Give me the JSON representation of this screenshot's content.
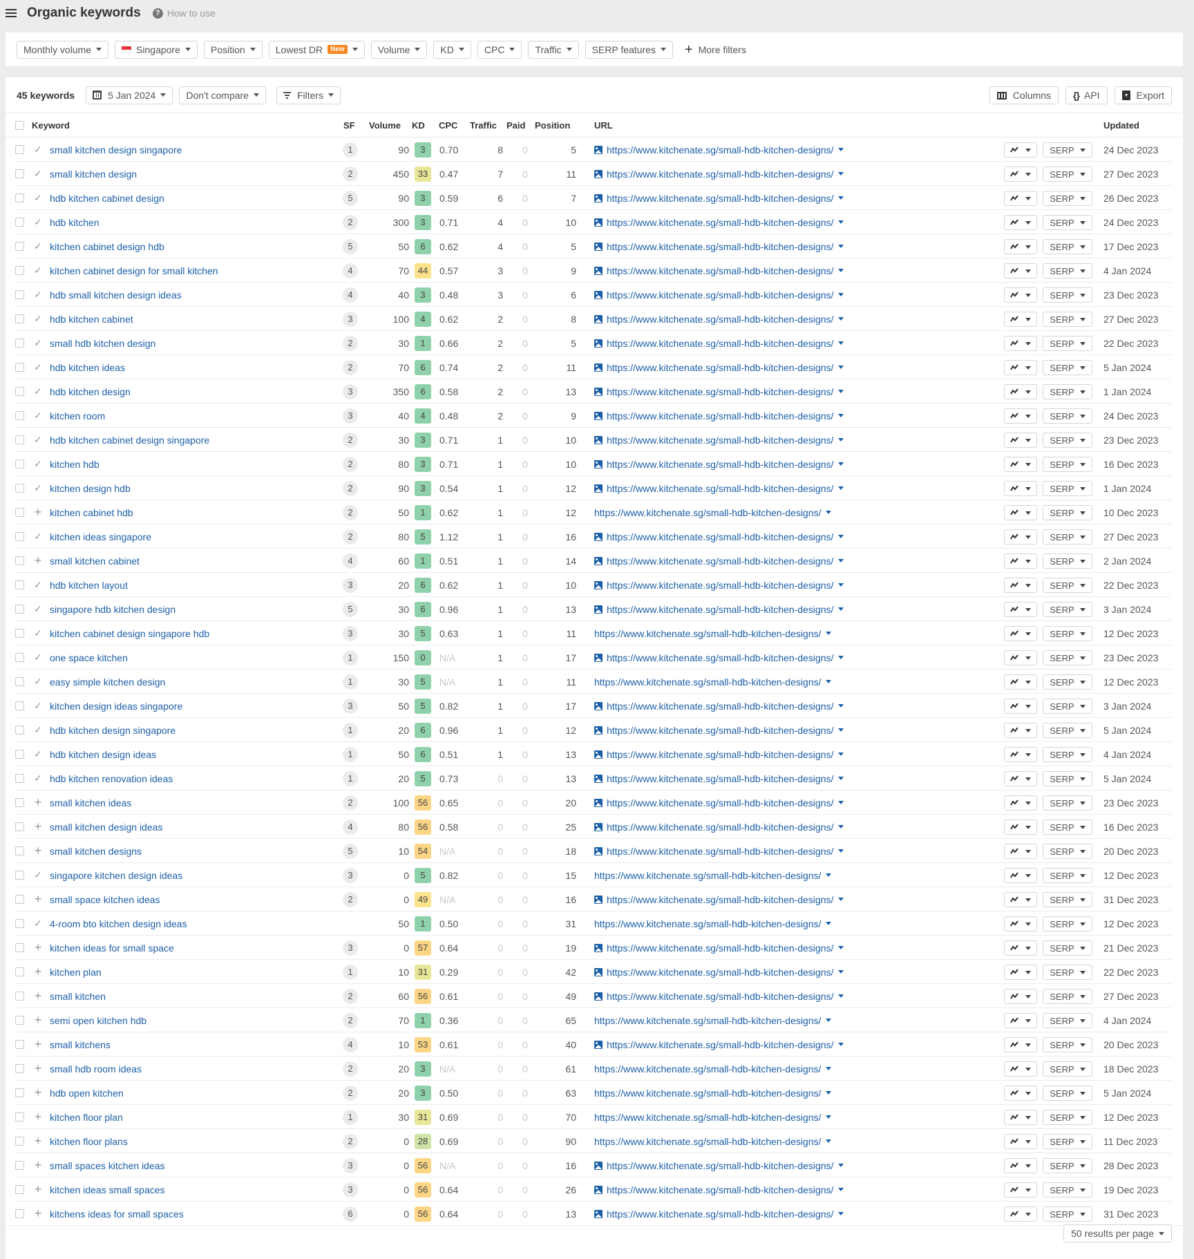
{
  "header": {
    "title": "Organic keywords",
    "help_label": "How to use"
  },
  "filters": {
    "buttons": [
      {
        "label": "Monthly volume"
      },
      {
        "label": "Singapore",
        "flag": "singapore-flag"
      },
      {
        "label": "Position"
      },
      {
        "label": "Lowest DR",
        "badge": "New"
      },
      {
        "label": "Volume"
      },
      {
        "label": "KD"
      },
      {
        "label": "CPC"
      },
      {
        "label": "Traffic"
      },
      {
        "label": "SERP features"
      }
    ],
    "more_filters_label": "More filters"
  },
  "toolbar": {
    "keyword_count": "45 keywords",
    "date_label": "5 Jan 2024",
    "compare_label": "Don't compare",
    "filters_label": "Filters",
    "columns_label": "Columns",
    "api_label": "API",
    "export_label": "Export"
  },
  "table": {
    "headers": {
      "keyword": "Keyword",
      "sf": "SF",
      "volume": "Volume",
      "kd": "KD",
      "cpc": "CPC",
      "traffic": "Traffic",
      "paid": "Paid",
      "position": "Position",
      "url": "URL",
      "updated": "Updated"
    },
    "serp_label": "SERP",
    "kd_colors": {
      "easy": "#8fd1aa",
      "low": "#cfe3a6",
      "medium": "#e8e697",
      "hard": "#fce28a",
      "harder": "#fdd685"
    },
    "rows": [
      {
        "status": "check",
        "keyword": "small kitchen design singapore",
        "sf": "1",
        "volume": "90",
        "kd": "3",
        "cpc": "0.70",
        "traffic": "8",
        "paid": "0",
        "position": "5",
        "url": "https://www.kitchenate.sg/small-hdb-kitchen-designs/",
        "has_image": true,
        "updated": "24 Dec 2023"
      },
      {
        "status": "check",
        "keyword": "small kitchen design",
        "sf": "2",
        "volume": "450",
        "kd": "33",
        "cpc": "0.47",
        "traffic": "7",
        "paid": "0",
        "position": "11",
        "url": "https://www.kitchenate.sg/small-hdb-kitchen-designs/",
        "has_image": true,
        "updated": "27 Dec 2023"
      },
      {
        "status": "check",
        "keyword": "hdb kitchen cabinet design",
        "sf": "5",
        "volume": "90",
        "kd": "3",
        "cpc": "0.59",
        "traffic": "6",
        "paid": "0",
        "position": "7",
        "url": "https://www.kitchenate.sg/small-hdb-kitchen-designs/",
        "has_image": true,
        "updated": "26 Dec 2023"
      },
      {
        "status": "check",
        "keyword": "hdb kitchen",
        "sf": "2",
        "volume": "300",
        "kd": "3",
        "cpc": "0.71",
        "traffic": "4",
        "paid": "0",
        "position": "10",
        "url": "https://www.kitchenate.sg/small-hdb-kitchen-designs/",
        "has_image": true,
        "updated": "24 Dec 2023"
      },
      {
        "status": "check",
        "keyword": "kitchen cabinet design hdb",
        "sf": "5",
        "volume": "50",
        "kd": "6",
        "cpc": "0.62",
        "traffic": "4",
        "paid": "0",
        "position": "5",
        "url": "https://www.kitchenate.sg/small-hdb-kitchen-designs/",
        "has_image": true,
        "updated": "17 Dec 2023"
      },
      {
        "status": "check",
        "keyword": "kitchen cabinet design for small kitchen",
        "sf": "4",
        "volume": "70",
        "kd": "44",
        "cpc": "0.57",
        "traffic": "3",
        "paid": "0",
        "position": "9",
        "url": "https://www.kitchenate.sg/small-hdb-kitchen-designs/",
        "has_image": true,
        "updated": "4 Jan 2024"
      },
      {
        "status": "check",
        "keyword": "hdb small kitchen design ideas",
        "sf": "4",
        "volume": "40",
        "kd": "3",
        "cpc": "0.48",
        "traffic": "3",
        "paid": "0",
        "position": "6",
        "url": "https://www.kitchenate.sg/small-hdb-kitchen-designs/",
        "has_image": true,
        "updated": "23 Dec 2023"
      },
      {
        "status": "check",
        "keyword": "hdb kitchen cabinet",
        "sf": "3",
        "volume": "100",
        "kd": "4",
        "cpc": "0.62",
        "traffic": "2",
        "paid": "0",
        "position": "8",
        "url": "https://www.kitchenate.sg/small-hdb-kitchen-designs/",
        "has_image": true,
        "updated": "27 Dec 2023"
      },
      {
        "status": "check",
        "keyword": "small hdb kitchen design",
        "sf": "2",
        "volume": "30",
        "kd": "1",
        "cpc": "0.66",
        "traffic": "2",
        "paid": "0",
        "position": "5",
        "url": "https://www.kitchenate.sg/small-hdb-kitchen-designs/",
        "has_image": true,
        "updated": "22 Dec 2023"
      },
      {
        "status": "check",
        "keyword": "hdb kitchen ideas",
        "sf": "2",
        "volume": "70",
        "kd": "6",
        "cpc": "0.74",
        "traffic": "2",
        "paid": "0",
        "position": "11",
        "url": "https://www.kitchenate.sg/small-hdb-kitchen-designs/",
        "has_image": true,
        "updated": "5 Jan 2024"
      },
      {
        "status": "check",
        "keyword": "hdb kitchen design",
        "sf": "3",
        "volume": "350",
        "kd": "6",
        "cpc": "0.58",
        "traffic": "2",
        "paid": "0",
        "position": "13",
        "url": "https://www.kitchenate.sg/small-hdb-kitchen-designs/",
        "has_image": true,
        "updated": "1 Jan 2024"
      },
      {
        "status": "check",
        "keyword": "kitchen room",
        "sf": "3",
        "volume": "40",
        "kd": "4",
        "cpc": "0.48",
        "traffic": "2",
        "paid": "0",
        "position": "9",
        "url": "https://www.kitchenate.sg/small-hdb-kitchen-designs/",
        "has_image": true,
        "updated": "24 Dec 2023"
      },
      {
        "status": "check",
        "keyword": "hdb kitchen cabinet design singapore",
        "sf": "2",
        "volume": "30",
        "kd": "3",
        "cpc": "0.71",
        "traffic": "1",
        "paid": "0",
        "position": "10",
        "url": "https://www.kitchenate.sg/small-hdb-kitchen-designs/",
        "has_image": true,
        "updated": "23 Dec 2023"
      },
      {
        "status": "check",
        "keyword": "kitchen hdb",
        "sf": "2",
        "volume": "80",
        "kd": "3",
        "cpc": "0.71",
        "traffic": "1",
        "paid": "0",
        "position": "10",
        "url": "https://www.kitchenate.sg/small-hdb-kitchen-designs/",
        "has_image": true,
        "updated": "16 Dec 2023"
      },
      {
        "status": "check",
        "keyword": "kitchen design hdb",
        "sf": "2",
        "volume": "90",
        "kd": "3",
        "cpc": "0.54",
        "traffic": "1",
        "paid": "0",
        "position": "12",
        "url": "https://www.kitchenate.sg/small-hdb-kitchen-designs/",
        "has_image": true,
        "updated": "1 Jan 2024"
      },
      {
        "status": "plus",
        "keyword": "kitchen cabinet hdb",
        "sf": "2",
        "volume": "50",
        "kd": "1",
        "cpc": "0.62",
        "traffic": "1",
        "paid": "0",
        "position": "12",
        "url": "https://www.kitchenate.sg/small-hdb-kitchen-designs/",
        "has_image": false,
        "updated": "10 Dec 2023"
      },
      {
        "status": "check",
        "keyword": "kitchen ideas singapore",
        "sf": "2",
        "volume": "80",
        "kd": "5",
        "cpc": "1.12",
        "traffic": "1",
        "paid": "0",
        "position": "16",
        "url": "https://www.kitchenate.sg/small-hdb-kitchen-designs/",
        "has_image": true,
        "updated": "27 Dec 2023"
      },
      {
        "status": "plus",
        "keyword": "small kitchen cabinet",
        "sf": "4",
        "volume": "60",
        "kd": "1",
        "cpc": "0.51",
        "traffic": "1",
        "paid": "0",
        "position": "14",
        "url": "https://www.kitchenate.sg/small-hdb-kitchen-designs/",
        "has_image": true,
        "updated": "2 Jan 2024"
      },
      {
        "status": "check",
        "keyword": "hdb kitchen layout",
        "sf": "3",
        "volume": "20",
        "kd": "6",
        "cpc": "0.62",
        "traffic": "1",
        "paid": "0",
        "position": "10",
        "url": "https://www.kitchenate.sg/small-hdb-kitchen-designs/",
        "has_image": true,
        "updated": "22 Dec 2023"
      },
      {
        "status": "check",
        "keyword": "singapore hdb kitchen design",
        "sf": "5",
        "volume": "30",
        "kd": "6",
        "cpc": "0.96",
        "traffic": "1",
        "paid": "0",
        "position": "13",
        "url": "https://www.kitchenate.sg/small-hdb-kitchen-designs/",
        "has_image": true,
        "updated": "3 Jan 2024"
      },
      {
        "status": "check",
        "keyword": "kitchen cabinet design singapore hdb",
        "sf": "3",
        "volume": "30",
        "kd": "5",
        "cpc": "0.63",
        "traffic": "1",
        "paid": "0",
        "position": "11",
        "url": "https://www.kitchenate.sg/small-hdb-kitchen-designs/",
        "has_image": false,
        "updated": "12 Dec 2023"
      },
      {
        "status": "check",
        "keyword": "one space kitchen",
        "sf": "1",
        "volume": "150",
        "kd": "0",
        "cpc": "N/A",
        "traffic": "1",
        "paid": "0",
        "position": "17",
        "url": "https://www.kitchenate.sg/small-hdb-kitchen-designs/",
        "has_image": true,
        "updated": "23 Dec 2023"
      },
      {
        "status": "check",
        "keyword": "easy simple kitchen design",
        "sf": "1",
        "volume": "30",
        "kd": "5",
        "cpc": "N/A",
        "traffic": "1",
        "paid": "0",
        "position": "11",
        "url": "https://www.kitchenate.sg/small-hdb-kitchen-designs/",
        "has_image": false,
        "updated": "12 Dec 2023"
      },
      {
        "status": "check",
        "keyword": "kitchen design ideas singapore",
        "sf": "3",
        "volume": "50",
        "kd": "5",
        "cpc": "0.82",
        "traffic": "1",
        "paid": "0",
        "position": "17",
        "url": "https://www.kitchenate.sg/small-hdb-kitchen-designs/",
        "has_image": true,
        "updated": "3 Jan 2024"
      },
      {
        "status": "check",
        "keyword": "hdb kitchen design singapore",
        "sf": "1",
        "volume": "20",
        "kd": "6",
        "cpc": "0.96",
        "traffic": "1",
        "paid": "0",
        "position": "12",
        "url": "https://www.kitchenate.sg/small-hdb-kitchen-designs/",
        "has_image": true,
        "updated": "5 Jan 2024"
      },
      {
        "status": "check",
        "keyword": "hdb kitchen design ideas",
        "sf": "1",
        "volume": "50",
        "kd": "6",
        "cpc": "0.51",
        "traffic": "1",
        "paid": "0",
        "position": "13",
        "url": "https://www.kitchenate.sg/small-hdb-kitchen-designs/",
        "has_image": true,
        "updated": "4 Jan 2024"
      },
      {
        "status": "check",
        "keyword": "hdb kitchen renovation ideas",
        "sf": "1",
        "volume": "20",
        "kd": "5",
        "cpc": "0.73",
        "traffic": "0",
        "paid": "0",
        "position": "13",
        "url": "https://www.kitchenate.sg/small-hdb-kitchen-designs/",
        "has_image": true,
        "updated": "5 Jan 2024"
      },
      {
        "status": "plus",
        "keyword": "small kitchen ideas",
        "sf": "2",
        "volume": "100",
        "kd": "56",
        "cpc": "0.65",
        "traffic": "0",
        "paid": "0",
        "position": "20",
        "url": "https://www.kitchenate.sg/small-hdb-kitchen-designs/",
        "has_image": true,
        "updated": "23 Dec 2023"
      },
      {
        "status": "plus",
        "keyword": "small kitchen design ideas",
        "sf": "4",
        "volume": "80",
        "kd": "56",
        "cpc": "0.58",
        "traffic": "0",
        "paid": "0",
        "position": "25",
        "url": "https://www.kitchenate.sg/small-hdb-kitchen-designs/",
        "has_image": true,
        "updated": "16 Dec 2023"
      },
      {
        "status": "plus",
        "keyword": "small kitchen designs",
        "sf": "5",
        "volume": "10",
        "kd": "54",
        "cpc": "N/A",
        "traffic": "0",
        "paid": "0",
        "position": "18",
        "url": "https://www.kitchenate.sg/small-hdb-kitchen-designs/",
        "has_image": true,
        "updated": "20 Dec 2023"
      },
      {
        "status": "check",
        "keyword": "singapore kitchen design ideas",
        "sf": "3",
        "volume": "0",
        "kd": "5",
        "cpc": "0.82",
        "traffic": "0",
        "paid": "0",
        "position": "15",
        "url": "https://www.kitchenate.sg/small-hdb-kitchen-designs/",
        "has_image": false,
        "updated": "12 Dec 2023"
      },
      {
        "status": "plus",
        "keyword": "small space kitchen ideas",
        "sf": "2",
        "volume": "0",
        "kd": "49",
        "cpc": "N/A",
        "traffic": "0",
        "paid": "0",
        "position": "16",
        "url": "https://www.kitchenate.sg/small-hdb-kitchen-designs/",
        "has_image": true,
        "updated": "31 Dec 2023"
      },
      {
        "status": "check",
        "keyword": "4-room bto kitchen design ideas",
        "sf": "",
        "volume": "50",
        "kd": "1",
        "cpc": "0.50",
        "traffic": "0",
        "paid": "0",
        "position": "31",
        "url": "https://www.kitchenate.sg/small-hdb-kitchen-designs/",
        "has_image": false,
        "updated": "12 Dec 2023"
      },
      {
        "status": "plus",
        "keyword": "kitchen ideas for small space",
        "sf": "3",
        "volume": "0",
        "kd": "57",
        "cpc": "0.64",
        "traffic": "0",
        "paid": "0",
        "position": "19",
        "url": "https://www.kitchenate.sg/small-hdb-kitchen-designs/",
        "has_image": true,
        "updated": "21 Dec 2023"
      },
      {
        "status": "plus",
        "keyword": "kitchen plan",
        "sf": "1",
        "volume": "10",
        "kd": "31",
        "cpc": "0.29",
        "traffic": "0",
        "paid": "0",
        "position": "42",
        "url": "https://www.kitchenate.sg/small-hdb-kitchen-designs/",
        "has_image": true,
        "updated": "22 Dec 2023"
      },
      {
        "status": "plus",
        "keyword": "small kitchen",
        "sf": "2",
        "volume": "60",
        "kd": "56",
        "cpc": "0.61",
        "traffic": "0",
        "paid": "0",
        "position": "49",
        "url": "https://www.kitchenate.sg/small-hdb-kitchen-designs/",
        "has_image": true,
        "updated": "27 Dec 2023"
      },
      {
        "status": "plus",
        "keyword": "semi open kitchen hdb",
        "sf": "2",
        "volume": "70",
        "kd": "1",
        "cpc": "0.36",
        "traffic": "0",
        "paid": "0",
        "position": "65",
        "url": "https://www.kitchenate.sg/small-hdb-kitchen-designs/",
        "has_image": false,
        "updated": "4 Jan 2024"
      },
      {
        "status": "plus",
        "keyword": "small kitchens",
        "sf": "4",
        "volume": "10",
        "kd": "53",
        "cpc": "0.61",
        "traffic": "0",
        "paid": "0",
        "position": "40",
        "url": "https://www.kitchenate.sg/small-hdb-kitchen-designs/",
        "has_image": true,
        "updated": "20 Dec 2023"
      },
      {
        "status": "plus",
        "keyword": "small hdb room ideas",
        "sf": "2",
        "volume": "20",
        "kd": "3",
        "cpc": "N/A",
        "traffic": "0",
        "paid": "0",
        "position": "61",
        "url": "https://www.kitchenate.sg/small-hdb-kitchen-designs/",
        "has_image": false,
        "updated": "18 Dec 2023"
      },
      {
        "status": "plus",
        "keyword": "hdb open kitchen",
        "sf": "2",
        "volume": "20",
        "kd": "3",
        "cpc": "0.50",
        "traffic": "0",
        "paid": "0",
        "position": "63",
        "url": "https://www.kitchenate.sg/small-hdb-kitchen-designs/",
        "has_image": false,
        "updated": "5 Jan 2024"
      },
      {
        "status": "plus",
        "keyword": "kitchen floor plan",
        "sf": "1",
        "volume": "30",
        "kd": "31",
        "cpc": "0.69",
        "traffic": "0",
        "paid": "0",
        "position": "70",
        "url": "https://www.kitchenate.sg/small-hdb-kitchen-designs/",
        "has_image": false,
        "updated": "12 Dec 2023"
      },
      {
        "status": "plus",
        "keyword": "kitchen floor plans",
        "sf": "2",
        "volume": "0",
        "kd": "28",
        "cpc": "0.69",
        "traffic": "0",
        "paid": "0",
        "position": "90",
        "url": "https://www.kitchenate.sg/small-hdb-kitchen-designs/",
        "has_image": false,
        "updated": "11 Dec 2023"
      },
      {
        "status": "plus",
        "keyword": "small spaces kitchen ideas",
        "sf": "3",
        "volume": "0",
        "kd": "56",
        "cpc": "N/A",
        "traffic": "0",
        "paid": "0",
        "position": "16",
        "url": "https://www.kitchenate.sg/small-hdb-kitchen-designs/",
        "has_image": true,
        "updated": "28 Dec 2023"
      },
      {
        "status": "plus",
        "keyword": "kitchen ideas small spaces",
        "sf": "3",
        "volume": "0",
        "kd": "56",
        "cpc": "0.64",
        "traffic": "0",
        "paid": "0",
        "position": "26",
        "url": "https://www.kitchenate.sg/small-hdb-kitchen-designs/",
        "has_image": true,
        "updated": "19 Dec 2023"
      },
      {
        "status": "plus",
        "keyword": "kitchens ideas for small spaces",
        "sf": "6",
        "volume": "0",
        "kd": "56",
        "cpc": "0.64",
        "traffic": "0",
        "paid": "0",
        "position": "13",
        "url": "https://www.kitchenate.sg/small-hdb-kitchen-designs/",
        "has_image": true,
        "updated": "31 Dec 2023"
      }
    ]
  },
  "pagination": {
    "per_page_label": "50 results per page"
  }
}
